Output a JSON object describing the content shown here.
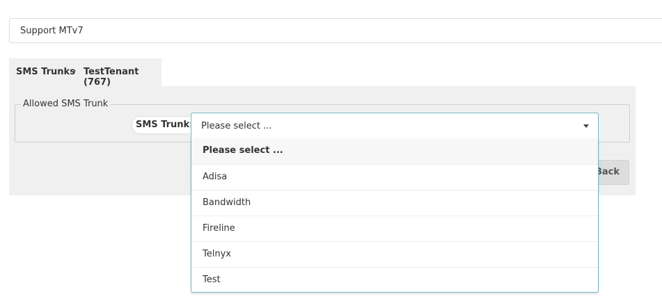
{
  "tenant_bar": {
    "label": "Support MTv7"
  },
  "breadcrumb": {
    "root": "SMS Trunks",
    "separator": "›",
    "current": "TestTenant (767)"
  },
  "form": {
    "legend": "Allowed SMS Trunk",
    "field_label": "SMS Trunk:",
    "select": {
      "value": "Please select ...",
      "options": [
        {
          "label": "Please select ...",
          "selected": true
        },
        {
          "label": "Adisa"
        },
        {
          "label": "Bandwidth"
        },
        {
          "label": "Fireline"
        },
        {
          "label": "Telnyx"
        },
        {
          "label": "Test"
        }
      ]
    },
    "back_button_label": "Back"
  },
  "colors": {
    "panel_bg": "#f0f0f0",
    "focus_border": "#76b5c4",
    "button_bg": "#dddddd"
  }
}
